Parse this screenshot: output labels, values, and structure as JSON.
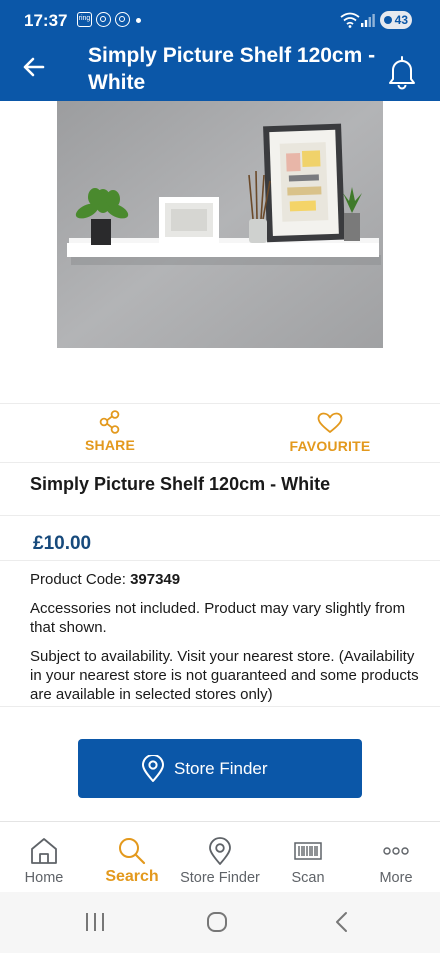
{
  "status_bar": {
    "time": "17:37",
    "ring_badge": "ring",
    "battery_level": "43"
  },
  "app_bar": {
    "title": "Simply Picture Shelf 120cm - White",
    "back_icon": "arrow-left-icon",
    "notification_icon": "bell-icon"
  },
  "product": {
    "image_alt": "white picture shelf",
    "title": "Simply Picture Shelf 120cm - White",
    "price": "£10.00",
    "code_label": "Product Code:",
    "code_value": "397349",
    "note": "Accessories not included. Product may vary slightly from that shown.",
    "availability": "Subject to availability. Visit your nearest store. (Availability in your nearest store is not guaranteed and some products are available in selected stores only)"
  },
  "actions": {
    "share_label": "SHARE",
    "favourite_label": "FAVOURITE"
  },
  "store_finder_button": {
    "label": "Store Finder"
  },
  "bottom_nav": {
    "items": [
      {
        "label": "Home",
        "icon": "home-icon"
      },
      {
        "label": "Search",
        "icon": "search-icon",
        "active": true
      },
      {
        "label": "Store Finder",
        "icon": "location-pin-icon"
      },
      {
        "label": "Scan",
        "icon": "barcode-icon"
      },
      {
        "label": "More",
        "icon": "more-dots-icon"
      }
    ]
  },
  "colors": {
    "brand_blue": "#0b57a8",
    "accent_orange": "#e3991d",
    "price_blue": "#174a7c"
  }
}
